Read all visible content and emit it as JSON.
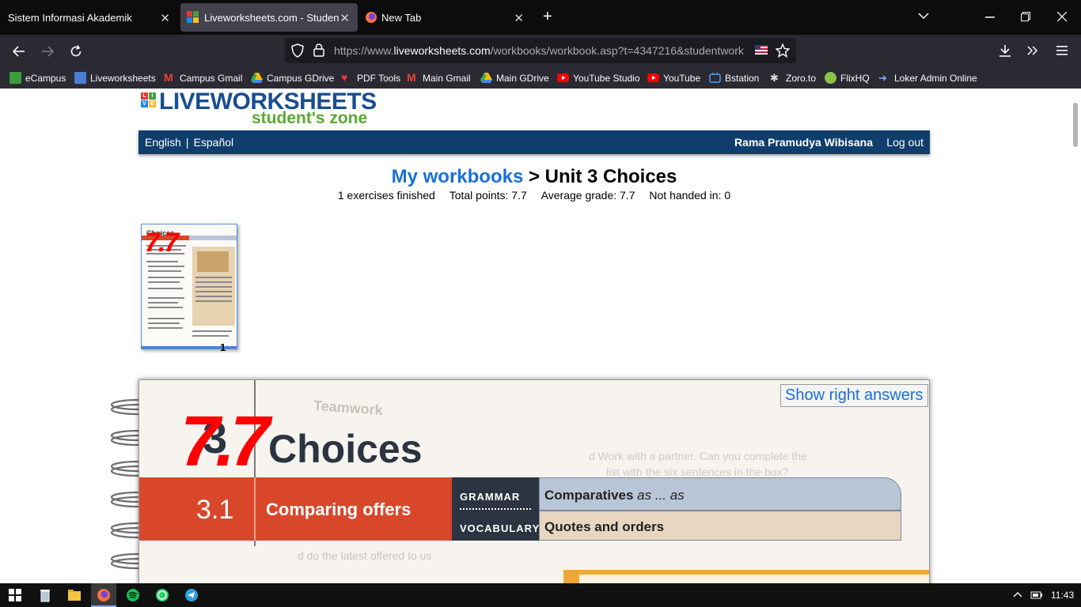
{
  "browser": {
    "tabs": [
      {
        "title": "Sistem Informasi Akademik"
      },
      {
        "title": "Liveworksheets.com - Student w"
      },
      {
        "title": "New Tab"
      }
    ],
    "close_glyph": "✕",
    "new_tab_glyph": "+",
    "url_prefix": "https://www.",
    "url_host": "liveworksheets.com",
    "url_path": "/workbooks/workbook.asp?t=4347216&studentwork",
    "bookmarks": [
      {
        "label": "eCampus",
        "icon": "ecampus-icon",
        "color": "#3b9e3b"
      },
      {
        "label": "Liveworksheets",
        "icon": "liveworksheets-icon",
        "color": "#4a7fd4"
      },
      {
        "label": "Campus Gmail",
        "icon": "gmail-icon",
        "color": "#ea4335"
      },
      {
        "label": "Campus GDrive",
        "icon": "gdrive-icon",
        "color": "#fbbc04"
      },
      {
        "label": "PDF Tools",
        "icon": "heart-icon",
        "color": "#e53935"
      },
      {
        "label": "Main Gmail",
        "icon": "gmail-icon",
        "color": "#ea4335"
      },
      {
        "label": "Main GDrive",
        "icon": "gdrive-icon",
        "color": "#fbbc04"
      },
      {
        "label": "YouTube Studio",
        "icon": "youtube-icon",
        "color": "#ff0000"
      },
      {
        "label": "YouTube",
        "icon": "youtube-icon",
        "color": "#ff0000"
      },
      {
        "label": "Bstation",
        "icon": "bstation-icon",
        "color": "#3aa3ff"
      },
      {
        "label": "Zoro.to",
        "icon": "zoro-icon",
        "color": "#dddddd"
      },
      {
        "label": "FlixHQ",
        "icon": "flixhq-icon",
        "color": "#8bc34a"
      },
      {
        "label": "Loker Admin Online",
        "icon": "arrow-icon",
        "color": "#7aa7ff"
      }
    ]
  },
  "site": {
    "logo_text": "LIVEWORKSHEETS",
    "logo_sub": "student's zone",
    "nav": {
      "english": "English",
      "separator": "|",
      "espanol": "Español",
      "user_name": "Rama Pramudya Wibisana",
      "logout": "Log out"
    },
    "breadcrumb": {
      "link": "My workbooks",
      "rest": " > Unit 3 Choices"
    },
    "stats": {
      "finished": "1 exercises finished",
      "total_points": "Total points: 7.7",
      "average": "Average grade: 7.7",
      "not_handed": "Not handed in: 0"
    },
    "thumbnail": {
      "page_number": "1",
      "grade": "7.7",
      "title": "Choices"
    },
    "worksheet": {
      "show_answers": "Show right answers",
      "grade": "7.7",
      "unit_number": "3",
      "title": "Choices",
      "section_number": "3.1",
      "section_title": "Comparing offers",
      "grammar_label": "GRAMMAR",
      "grammar_value": "Comparatives",
      "grammar_value_em": "as ... as",
      "vocab_label": "VOCABULARY",
      "vocab_value": "Quotes and orders",
      "faded_heading": "Teamwork",
      "faded_text_1": "d Work with a partner. Can you complete the",
      "faded_text_2": "list with the six sentences in the box?",
      "faded_text_3": "d  do the latest offered to us"
    },
    "colors": {
      "nav_bg": "#0f3e6c",
      "link_blue": "#1a6fd8",
      "banner_red": "#d9472b",
      "banner_dark": "#2b3440",
      "grade_red": "#ff0000"
    }
  },
  "taskbar": {
    "time": "11:43",
    "apps": [
      "start-icon",
      "recycle-bin-icon",
      "file-explorer-icon",
      "firefox-icon",
      "spotify-icon",
      "whatsapp-icon",
      "telegram-icon"
    ]
  }
}
